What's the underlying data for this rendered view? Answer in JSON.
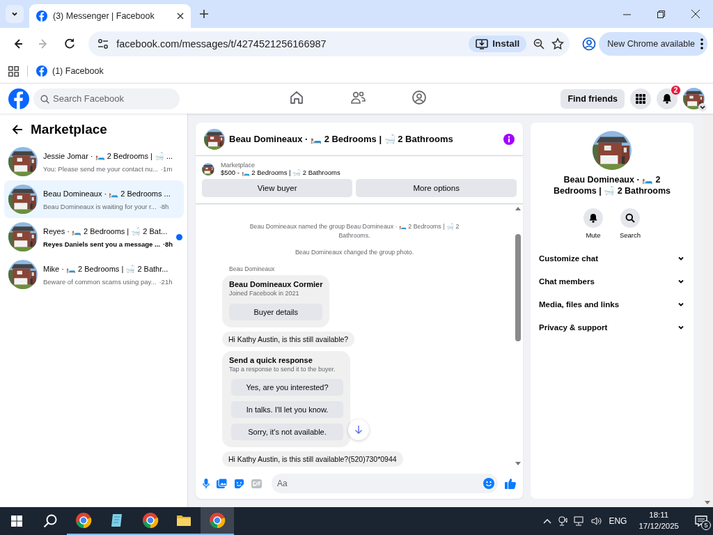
{
  "browser": {
    "tabs": [
      {
        "title": "(3) Messenger | Facebook",
        "selected": true
      }
    ],
    "nav": [
      {
        "kind": "back",
        "disabled": false
      },
      {
        "kind": "forward",
        "disabled": true
      },
      {
        "kind": "reload",
        "disabled": false
      }
    ],
    "url": "facebook.com/messages/t/4274521256166987",
    "install": "Install",
    "update": "New Chrome available",
    "bookmarks": [
      {
        "title": "(1) Facebook"
      }
    ]
  },
  "facebook": {
    "search_placeholder": "Search Facebook",
    "nav": [
      {
        "kind": "home",
        "selected": false
      },
      {
        "kind": "friends",
        "selected": false
      },
      {
        "kind": "groups",
        "selected": false
      }
    ],
    "find_friends": "Find friends",
    "notifications": "2"
  },
  "sidebar": {
    "title": "Marketplace",
    "conversations": [
      {
        "title": "Jessie Jomar · 🛏️ 2 Bedrooms | 🛁 ...",
        "preview": "You: Please send me your contact nu...",
        "time": "·1m",
        "selected": false,
        "unread": false
      },
      {
        "title": "Beau Domineaux · 🛏️ 2 Bedrooms ...",
        "preview": "Beau Domineaux is waiting for your r...",
        "time": "·8h",
        "selected": true,
        "unread": false
      },
      {
        "title": "Reyes · 🛏️ 2 Bedrooms | 🛁 2 Bat...",
        "preview": "Reyes Daniels sent you a message ...",
        "time": "·8h",
        "selected": false,
        "unread": true
      },
      {
        "title": "Mike · 🛏️ 2 Bedrooms | 🛁 2 Bathr...",
        "preview": "Beware of common scams using pay...",
        "time": "·21h",
        "selected": false,
        "unread": false
      }
    ]
  },
  "chat": {
    "title": "Beau Domineaux · 🛏️ 2 Bedrooms | 🛁 2 Bathrooms",
    "listing": {
      "label": "Marketplace",
      "summary": "$500 - 🛏️ 2 Bedrooms | 🛁 2 Bathrooms",
      "buttons": [
        "View buyer",
        "More options"
      ]
    },
    "messages": [
      {
        "kind": "event",
        "text": "Beau Domineaux named the group Beau Domineaux · 🛏️ 2 Bedrooms | 🛁 2 Bathrooms."
      },
      {
        "kind": "event",
        "text": "Beau Domineaux changed the group photo."
      },
      {
        "kind": "sender",
        "text": "Beau Domineaux"
      },
      {
        "kind": "card",
        "title": "Beau Domineaux Cormier",
        "subtitle": "Joined Facebook in 2021",
        "button": "Buyer details"
      },
      {
        "kind": "bubble",
        "text": "Hi Kathy Austin, is this still available?"
      },
      {
        "kind": "quick",
        "title": "Send a quick response",
        "subtitle": "Tap a response to send it to the buyer.",
        "options": [
          "Yes, are you interested?",
          "In talks. I'll let you know.",
          "Sorry, it's not available."
        ]
      },
      {
        "kind": "bubble",
        "text": "Hi Kathy Austin, is this still available?(520)730*0944"
      }
    ],
    "composer_placeholder": "Aa"
  },
  "details": {
    "title": "Beau Domineaux · 🛏️ 2 Bedrooms | 🛁 2 Bathrooms",
    "actions": [
      {
        "kind": "mute",
        "label": "Mute"
      },
      {
        "kind": "search",
        "label": "Search"
      }
    ],
    "sections": [
      "Customize chat",
      "Chat members",
      "Media, files and links",
      "Privacy & support"
    ]
  },
  "taskbar": {
    "apps": [
      {
        "kind": "browser",
        "selected": false
      },
      {
        "kind": "notepad",
        "selected": false
      },
      {
        "kind": "browser",
        "selected": false
      },
      {
        "kind": "folder",
        "selected": false
      },
      {
        "kind": "browser",
        "selected": true
      }
    ],
    "language": "ENG",
    "time": "18:11",
    "date": "17/12/2025",
    "notifications": "5"
  }
}
